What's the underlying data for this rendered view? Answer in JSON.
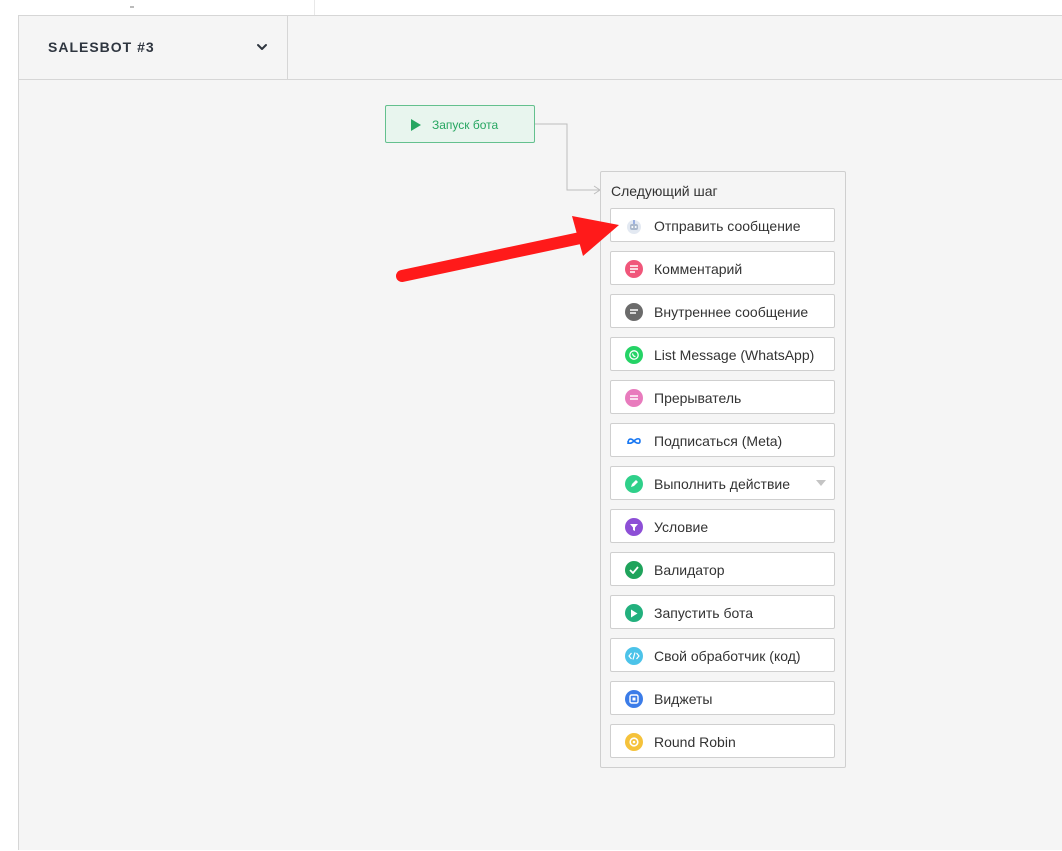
{
  "header": {
    "bot_name": "SALESBOT #3"
  },
  "start_node": {
    "label": "Запуск бота"
  },
  "next_step": {
    "title": "Следующий шаг",
    "options": [
      {
        "label": "Отправить сообщение",
        "icon": "robot-icon",
        "color": "#aab8cc"
      },
      {
        "label": "Комментарий",
        "icon": "comment-icon",
        "color": "#f0567a"
      },
      {
        "label": "Внутреннее сообщение",
        "icon": "internal-message-icon",
        "color": "#6b6b6b"
      },
      {
        "label": "List Message (WhatsApp)",
        "icon": "whatsapp-icon",
        "color": "#25d366"
      },
      {
        "label": "Прерыватель",
        "icon": "breaker-icon",
        "color": "#e87bbd"
      },
      {
        "label": "Подписаться (Meta)",
        "icon": "meta-icon",
        "color": "#1877f2"
      },
      {
        "label": "Выполнить действие",
        "icon": "pencil-icon",
        "color": "#2fd08a",
        "has_dropdown": true
      },
      {
        "label": "Условие",
        "icon": "filter-icon",
        "color": "#8d4fd6"
      },
      {
        "label": "Валидатор",
        "icon": "check-icon",
        "color": "#1fa35b"
      },
      {
        "label": "Запустить бота",
        "icon": "play-icon",
        "color": "#22b07d"
      },
      {
        "label": "Свой обработчик (код)",
        "icon": "code-icon",
        "color": "#4cc3e9"
      },
      {
        "label": "Виджеты",
        "icon": "widget-icon",
        "color": "#3b7ce8"
      },
      {
        "label": "Round Robin",
        "icon": "round-robin-icon",
        "color": "#f5c23b"
      }
    ]
  },
  "annotation": {
    "arrow_color": "#ff1a1a"
  }
}
